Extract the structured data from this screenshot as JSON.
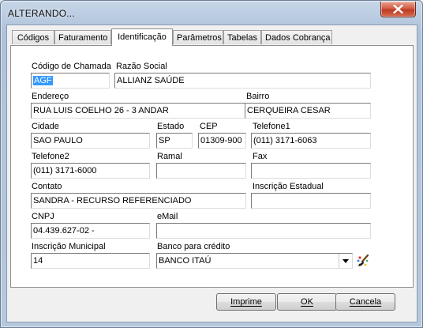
{
  "window": {
    "title": "ALTERANDO..."
  },
  "tabs": [
    {
      "label": "Códigos"
    },
    {
      "label": "Faturamento"
    },
    {
      "label": "Identificação"
    },
    {
      "label": "Parâmetros"
    },
    {
      "label": "Tabelas"
    },
    {
      "label": "Dados Cobrança"
    }
  ],
  "active_tab": "Identificação",
  "form": {
    "codigo_chamada": {
      "label": "Código de Chamada",
      "value": "AGF"
    },
    "razao_social": {
      "label": "Razão Social",
      "value": "ALLIANZ SAÚDE"
    },
    "endereco": {
      "label": "Endereço",
      "value": "RUA LUIS COELHO  26 - 3 ANDAR"
    },
    "bairro": {
      "label": "Bairro",
      "value": "CERQUEIRA CESAR"
    },
    "cidade": {
      "label": "Cidade",
      "value": "SAO PAULO"
    },
    "estado": {
      "label": "Estado",
      "value": "SP"
    },
    "cep": {
      "label": "CEP",
      "value": "01309-900"
    },
    "telefone1": {
      "label": "Telefone1",
      "value": "(011) 3171-6063"
    },
    "telefone2": {
      "label": "Telefone2",
      "value": "(011) 3171-6000"
    },
    "ramal": {
      "label": "Ramal",
      "value": ""
    },
    "fax": {
      "label": "Fax",
      "value": ""
    },
    "contato": {
      "label": "Contato",
      "value": "SANDRA - RECURSO REFERENCIADO"
    },
    "inscricao_estadual": {
      "label": "Inscrição Estadual",
      "value": ""
    },
    "cnpj": {
      "label": "CNPJ",
      "value": "04.439.627-02  -"
    },
    "email": {
      "label": "eMail",
      "value": ""
    },
    "inscricao_municipal": {
      "label": "Inscrição Municipal",
      "value": "14"
    },
    "banco_credito": {
      "label": "Banco para crédito",
      "value": "BANCO ITAÚ"
    }
  },
  "buttons": {
    "imprime": "Imprime",
    "ok": "OK",
    "cancela": "Cancela"
  },
  "icons": {
    "close": "close-icon",
    "combo": "chevron-down-icon",
    "bank_edit": "paint-brush-icon"
  }
}
